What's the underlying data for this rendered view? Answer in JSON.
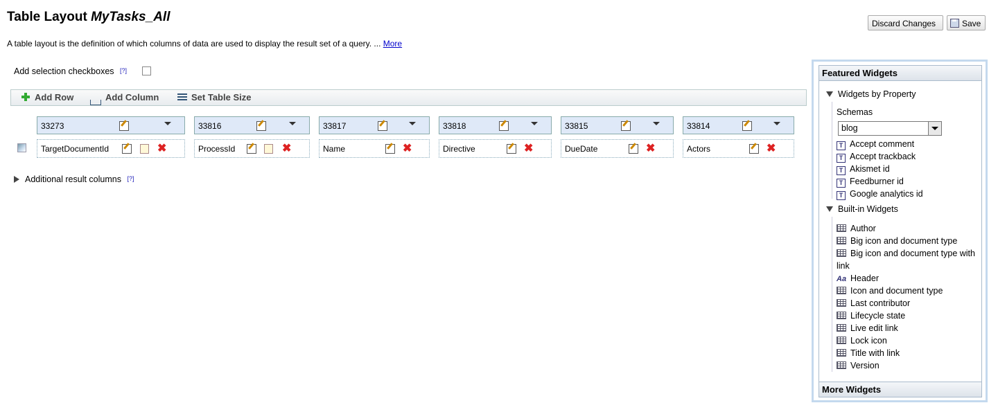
{
  "page": {
    "title": "Table Layout",
    "title_name": "MyTasks_All",
    "description": "A table layout is the definition of which columns of data are used to display the result set of a query. ...",
    "more_link": "More"
  },
  "actions": {
    "discard_label": "Discard Changes",
    "save_label": "Save"
  },
  "selection": {
    "label": "Add selection checkboxes",
    "help": "[?]",
    "checked": false
  },
  "toolbar": {
    "add_row": "Add Row",
    "add_column": "Add Column",
    "set_table_size": "Set Table Size"
  },
  "columns": [
    {
      "id": "33273",
      "field": "TargetDocumentId"
    },
    {
      "id": "33816",
      "field": "ProcessId"
    },
    {
      "id": "33817",
      "field": "Name"
    },
    {
      "id": "33818",
      "field": "Directive"
    },
    {
      "id": "33815",
      "field": "DueDate"
    },
    {
      "id": "33814",
      "field": "Actors"
    }
  ],
  "additional": {
    "label": "Additional result columns",
    "help": "[?]"
  },
  "panel": {
    "title": "Featured Widgets",
    "by_property": "Widgets by Property",
    "schemas_label": "Schemas",
    "schema_value": "blog",
    "property_widgets": [
      "Accept comment",
      "Accept trackback",
      "Akismet id",
      "Feedburner id",
      "Google analytics id"
    ],
    "builtin": "Built-in Widgets",
    "builtin_widgets": [
      {
        "label": "Author",
        "icon": "table-icon"
      },
      {
        "label": "Big icon and document type",
        "icon": "table-icon"
      },
      {
        "label": "Big icon and document type with link",
        "icon": "table-icon"
      },
      {
        "label": "Header",
        "icon": "text-aa-icon"
      },
      {
        "label": "Icon and document type",
        "icon": "table-icon"
      },
      {
        "label": "Last contributor",
        "icon": "table-icon"
      },
      {
        "label": "Lifecycle state",
        "icon": "table-icon"
      },
      {
        "label": "Live edit link",
        "icon": "table-icon"
      },
      {
        "label": "Lock icon",
        "icon": "table-icon"
      },
      {
        "label": "Title with link",
        "icon": "table-icon"
      },
      {
        "label": "Version",
        "icon": "table-icon"
      }
    ],
    "more": "More Widgets"
  }
}
